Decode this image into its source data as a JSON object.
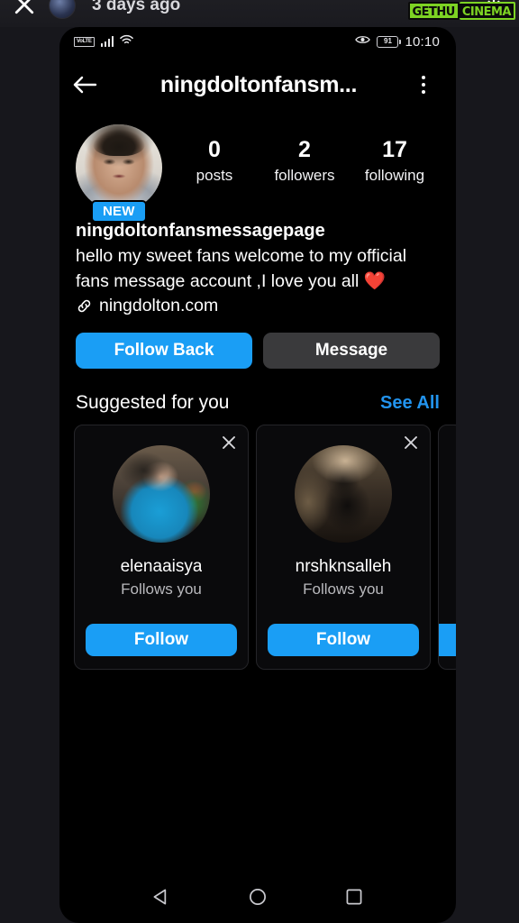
{
  "overlay": {
    "close_icon": "close-icon",
    "timestamp": "3 days ago",
    "download_icon": "download-icon",
    "watermark_part1": "GETHU",
    "watermark_part2": "CINEMA"
  },
  "status_bar": {
    "carrier_badge": "VoLTE",
    "signal_icon": "signal-bars-icon",
    "wifi_icon": "wifi-icon",
    "eye_icon": "eye-icon",
    "battery_level": "91",
    "time": "10:10"
  },
  "header": {
    "back_icon": "back-arrow-icon",
    "title": "ningdoltonfansm...",
    "menu_icon": "overflow-menu-icon"
  },
  "profile": {
    "avatar_name": "profile-avatar",
    "new_badge": "NEW",
    "stats": [
      {
        "value": "0",
        "label": "posts"
      },
      {
        "value": "2",
        "label": "followers"
      },
      {
        "value": "17",
        "label": "following"
      }
    ],
    "display_name": "ningdoltonfansmessagepage",
    "bio_line1": "hello my sweet fans welcome to my official",
    "bio_line2": "fans message account ,I love you all ❤️",
    "link_icon": "chain-link-icon",
    "link_text": "ningdolton.com"
  },
  "actions": {
    "primary_label": "Follow Back",
    "secondary_label": "Message",
    "primary_color": "#1a9ef5",
    "secondary_color": "#3a3a3c"
  },
  "suggested": {
    "title": "Suggested for you",
    "see_all_label": "See All",
    "see_all_color": "#2294ef",
    "cards": [
      {
        "username": "elenaaisya",
        "relation": "Follows you",
        "follow_label": "Follow",
        "close_icon": "close-icon",
        "avatar_name": "suggestion-avatar"
      },
      {
        "username": "nrshknsalleh",
        "relation": "Follows you",
        "follow_label": "Follow",
        "close_icon": "close-icon",
        "avatar_name": "suggestion-avatar"
      }
    ]
  },
  "navbar": {
    "back_icon": "nav-back-icon",
    "home_icon": "nav-home-icon",
    "recents_icon": "nav-recents-icon"
  }
}
